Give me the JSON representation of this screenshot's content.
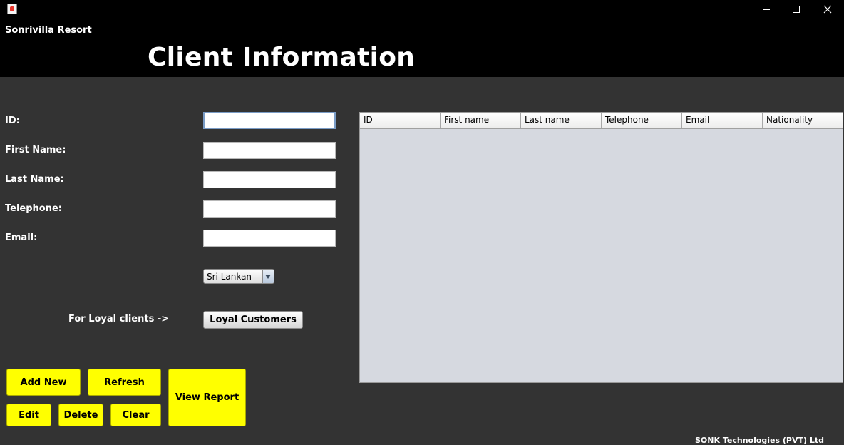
{
  "window": {
    "minimize_label": "Minimize",
    "maximize_label": "Maximize",
    "close_label": "Close"
  },
  "header": {
    "company": "Sonrivilla Resort",
    "title": "Client Information"
  },
  "form": {
    "id_label": "ID:",
    "first_name_label": "First Name:",
    "last_name_label": "Last Name:",
    "telephone_label": "Telephone:",
    "email_label": "Email:",
    "id_value": "",
    "first_name_value": "",
    "last_name_value": "",
    "telephone_value": "",
    "email_value": "",
    "nationality_selected": "Sri Lankan",
    "loyal_text": "For Loyal clients ->",
    "loyal_button": "Loyal Customers"
  },
  "actions": {
    "add_new": "Add New",
    "refresh": "Refresh",
    "edit": "Edit",
    "delete": "Delete",
    "clear": "Clear",
    "view_report": "View Report"
  },
  "table": {
    "columns": [
      "ID",
      "First name",
      "Last name",
      "Telephone",
      "Email",
      "Nationality"
    ],
    "rows": []
  },
  "footer": {
    "text": "SONK Technologies (PVT) Ltd"
  },
  "colors": {
    "header_bg": "#000000",
    "body_bg": "#333333",
    "action_button": "#ffff00",
    "table_bg": "#d6d9e0"
  },
  "icons": [
    "java-app-icon",
    "minimize-icon",
    "maximize-icon",
    "close-icon",
    "chevron-down-icon"
  ]
}
